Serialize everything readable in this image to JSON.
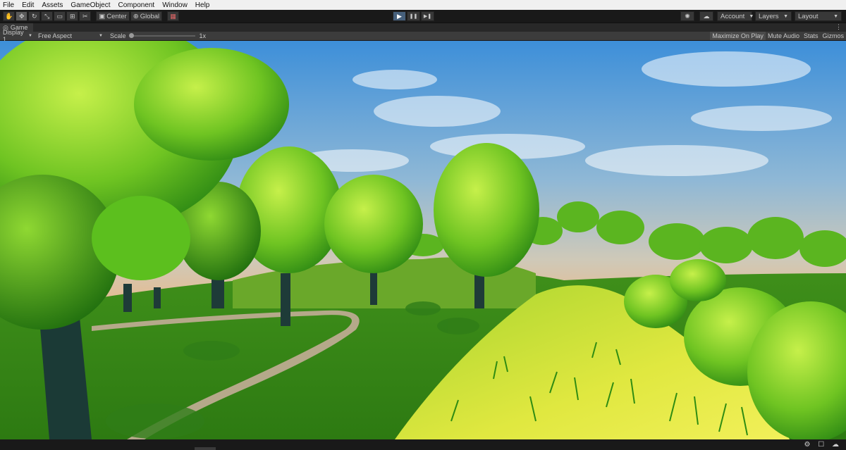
{
  "menu": [
    "File",
    "Edit",
    "Assets",
    "GameObject",
    "Component",
    "Window",
    "Help"
  ],
  "toolbar": {
    "tools": [
      {
        "icon": "hand-tool-icon",
        "glyph": "✋"
      },
      {
        "icon": "move-tool-icon",
        "glyph": "✥"
      },
      {
        "icon": "rotate-tool-icon",
        "glyph": "↻"
      },
      {
        "icon": "scale-tool-icon",
        "glyph": "⤡"
      },
      {
        "icon": "rect-tool-icon",
        "glyph": "▭"
      },
      {
        "icon": "transform-tool-icon",
        "glyph": "⊞"
      },
      {
        "icon": "custom-tool-icon",
        "glyph": "✂"
      }
    ],
    "pivot_label": "Center",
    "space_label": "Global",
    "snap_glyph": "▦",
    "play_glyph": "▶",
    "pause_glyph": "❚❚",
    "step_glyph": "▶❚",
    "settings_glyph": "✺",
    "cloud_glyph": "☁",
    "account_label": "Account",
    "layers_label": "Layers",
    "layout_label": "Layout"
  },
  "game_tab": {
    "icon_glyph": "◎",
    "label": "Game",
    "menu_glyph": "⋮"
  },
  "game_toolbar": {
    "display": "Display 1",
    "aspect": "Free Aspect",
    "scale_label": "Scale",
    "scale_value": "1x",
    "maximize": "Maximize On Play",
    "mute": "Mute Audio",
    "stats": "Stats",
    "gizmos": "Gizmos"
  },
  "status_icons": "⚙ ☐ ☁",
  "colors": {
    "play_active": "#46607c",
    "sky_top": "#3d8fd9",
    "horizon": "#f2b47a",
    "grass": "#9fd22a"
  }
}
